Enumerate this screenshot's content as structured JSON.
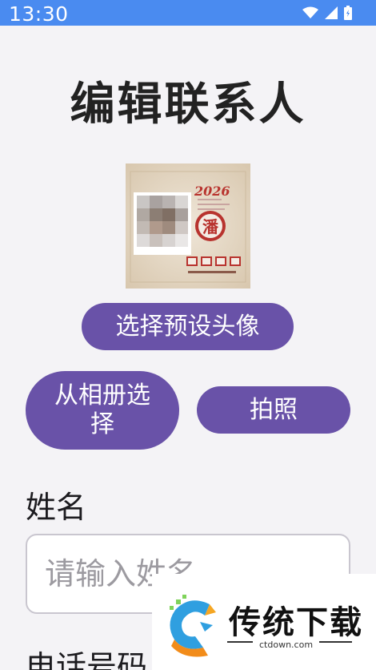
{
  "status_bar": {
    "time": "13:30",
    "icons": [
      "wifi-icon",
      "signal-icon",
      "battery-icon"
    ]
  },
  "title": "编辑联系人",
  "avatar": {
    "image": "avatar-image",
    "poster_year": "2026",
    "poster_character": "潘"
  },
  "buttons": {
    "preset_avatar": "选择预设头像",
    "album": "从相册选择",
    "camera": "拍照"
  },
  "form": {
    "name_label": "姓名",
    "name_placeholder": "请输入姓名",
    "phone_label": "电话号码"
  },
  "watermark": {
    "brand": "传统下载",
    "url": "ctdown.com"
  },
  "colors": {
    "status_bar": "#4a8bf0",
    "button": "#6952a8",
    "background": "#f4f3f6"
  }
}
